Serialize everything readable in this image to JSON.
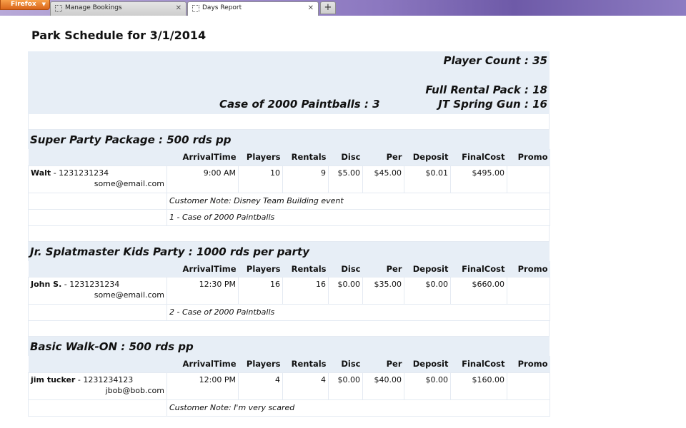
{
  "browser": {
    "menu_label": "Firefox",
    "tabs": [
      {
        "label": "Manage Bookings",
        "active": false
      },
      {
        "label": "Days Report",
        "active": true
      }
    ],
    "new_tab_symbol": "+"
  },
  "page": {
    "title": "Park Schedule for 3/1/2014"
  },
  "summary": {
    "player_count": "Player Count : 35",
    "full_rental": "Full Rental Pack : 18",
    "paintballs": "Case of 2000 Paintballs : 3",
    "spring_gun": "JT Spring Gun : 16"
  },
  "columns": [
    "ArrivalTime",
    "Players",
    "Rentals",
    "Disc",
    "Per",
    "Deposit",
    "FinalCost",
    "Promo"
  ],
  "packages": [
    {
      "title": "Super Party Package : 500 rds pp",
      "bookings": [
        {
          "name": "Walt",
          "phone": " - 1231231234",
          "email": "some@email.com",
          "arrival": "9:00 AM",
          "players": "10",
          "rentals": "9",
          "disc": "$5.00",
          "per": "$45.00",
          "deposit": "$0.01",
          "final": "$495.00",
          "promo": "",
          "notes": [
            "Customer Note: Disney Team Building event",
            "1 - Case of 2000 Paintballs"
          ]
        }
      ]
    },
    {
      "title": "Jr. Splatmaster Kids Party : 1000 rds per party",
      "bookings": [
        {
          "name": "John S.",
          "phone": " - 1231231234",
          "email": "some@email.com",
          "arrival": "12:30 PM",
          "players": "16",
          "rentals": "16",
          "disc": "$0.00",
          "per": "$35.00",
          "deposit": "$0.00",
          "final": "$660.00",
          "promo": "",
          "notes": [
            "2 - Case of 2000 Paintballs"
          ]
        }
      ]
    },
    {
      "title": "Basic Walk-ON : 500 rds pp",
      "bookings": [
        {
          "name": "jim tucker",
          "phone": " - 1231234123",
          "email": "jbob@bob.com",
          "arrival": "12:00 PM",
          "players": "4",
          "rentals": "4",
          "disc": "$0.00",
          "per": "$40.00",
          "deposit": "$0.00",
          "final": "$160.00",
          "promo": "",
          "notes": [
            "Customer Note: I'm very scared"
          ]
        }
      ]
    }
  ]
}
